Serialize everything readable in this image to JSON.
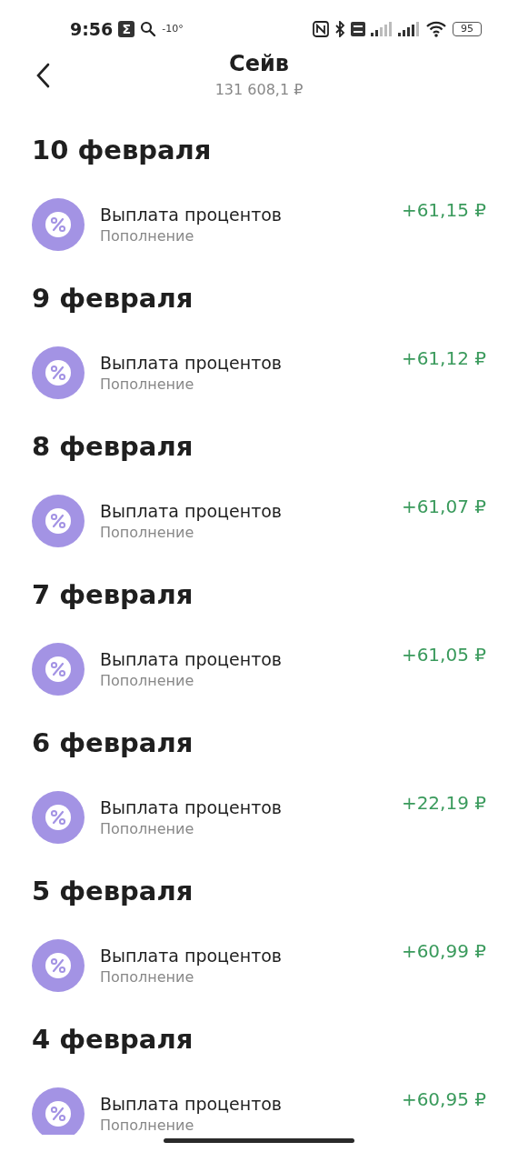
{
  "status_bar": {
    "time": "9:56",
    "notification_glyph": "Σ",
    "temperature": "-10°",
    "battery": "95"
  },
  "header": {
    "title": "Сейв",
    "balance": "131 608,1 ₽"
  },
  "days": [
    {
      "date": "10 февраля",
      "transactions": [
        {
          "title": "Выплата процентов",
          "category": "Пополнение",
          "amount": "+61,15 ₽"
        }
      ]
    },
    {
      "date": "9 февраля",
      "transactions": [
        {
          "title": "Выплата процентов",
          "category": "Пополнение",
          "amount": "+61,12 ₽"
        }
      ]
    },
    {
      "date": "8 февраля",
      "transactions": [
        {
          "title": "Выплата процентов",
          "category": "Пополнение",
          "amount": "+61,07 ₽"
        }
      ]
    },
    {
      "date": "7 февраля",
      "transactions": [
        {
          "title": "Выплата процентов",
          "category": "Пополнение",
          "amount": "+61,05 ₽"
        }
      ]
    },
    {
      "date": "6 февраля",
      "transactions": [
        {
          "title": "Выплата процентов",
          "category": "Пополнение",
          "amount": "+22,19 ₽"
        }
      ]
    },
    {
      "date": "5 февраля",
      "transactions": [
        {
          "title": "Выплата процентов",
          "category": "Пополнение",
          "amount": "+60,99 ₽"
        }
      ]
    },
    {
      "date": "4 февраля",
      "transactions": [
        {
          "title": "Выплата процентов",
          "category": "Пополнение",
          "amount": "+60,95 ₽"
        }
      ]
    }
  ]
}
